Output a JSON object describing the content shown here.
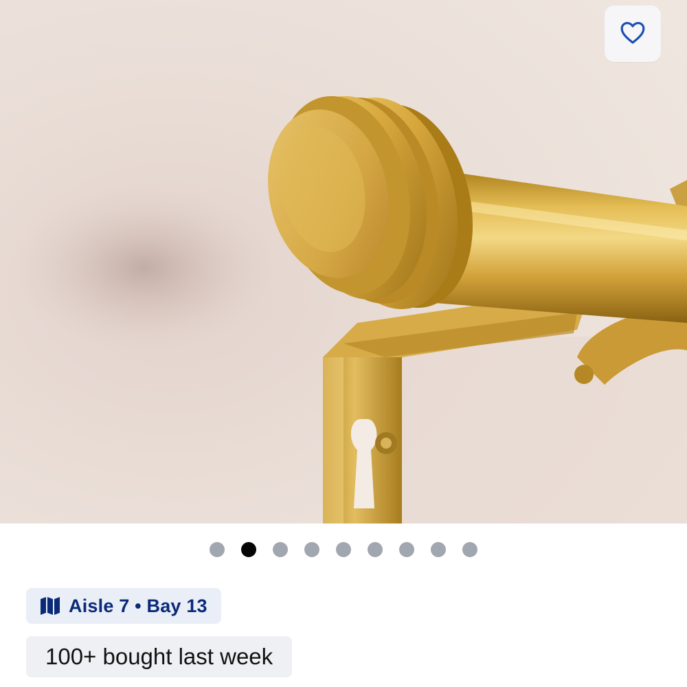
{
  "product_image": {
    "alt_icon": "curtain-rod-photo"
  },
  "favorite": {
    "icon": "heart-outline-icon",
    "color": "#1a4fb0"
  },
  "pager": {
    "total": 9,
    "active_index": 1
  },
  "location": {
    "icon": "map-icon",
    "text": "Aisle 7 • Bay 13",
    "color": "#0a2a78"
  },
  "social_proof": {
    "text": "100+ bought last week"
  }
}
